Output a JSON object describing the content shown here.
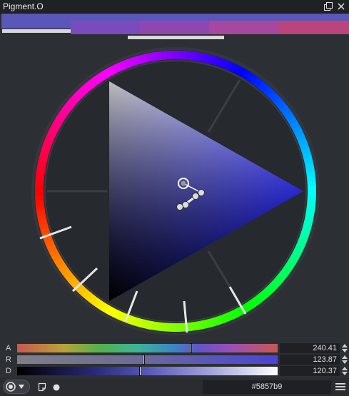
{
  "window": {
    "title": "Pigment.O"
  },
  "titlebar": {
    "icons": [
      "float-icon",
      "close-icon"
    ]
  },
  "history": {
    "swatches": [
      "#5b57b9",
      "#7a4bbd",
      "#8f47b0",
      "#a7479f",
      "#b9457c"
    ]
  },
  "sliders": [
    {
      "label": "A",
      "value": "240.41",
      "level": 0.668
    },
    {
      "label": "R",
      "value": "123.87",
      "level": 0.485
    },
    {
      "label": "D",
      "value": "120.37",
      "level": 0.472
    }
  ],
  "bottom": {
    "hex": "#5857b9",
    "icons": [
      "circle-mode-icon",
      "dropdown-icon",
      "note-icon",
      "dot-icon",
      "menu-icon"
    ]
  },
  "colors": {
    "current": "#5857b9",
    "hue_vertex": "#0000ff"
  }
}
